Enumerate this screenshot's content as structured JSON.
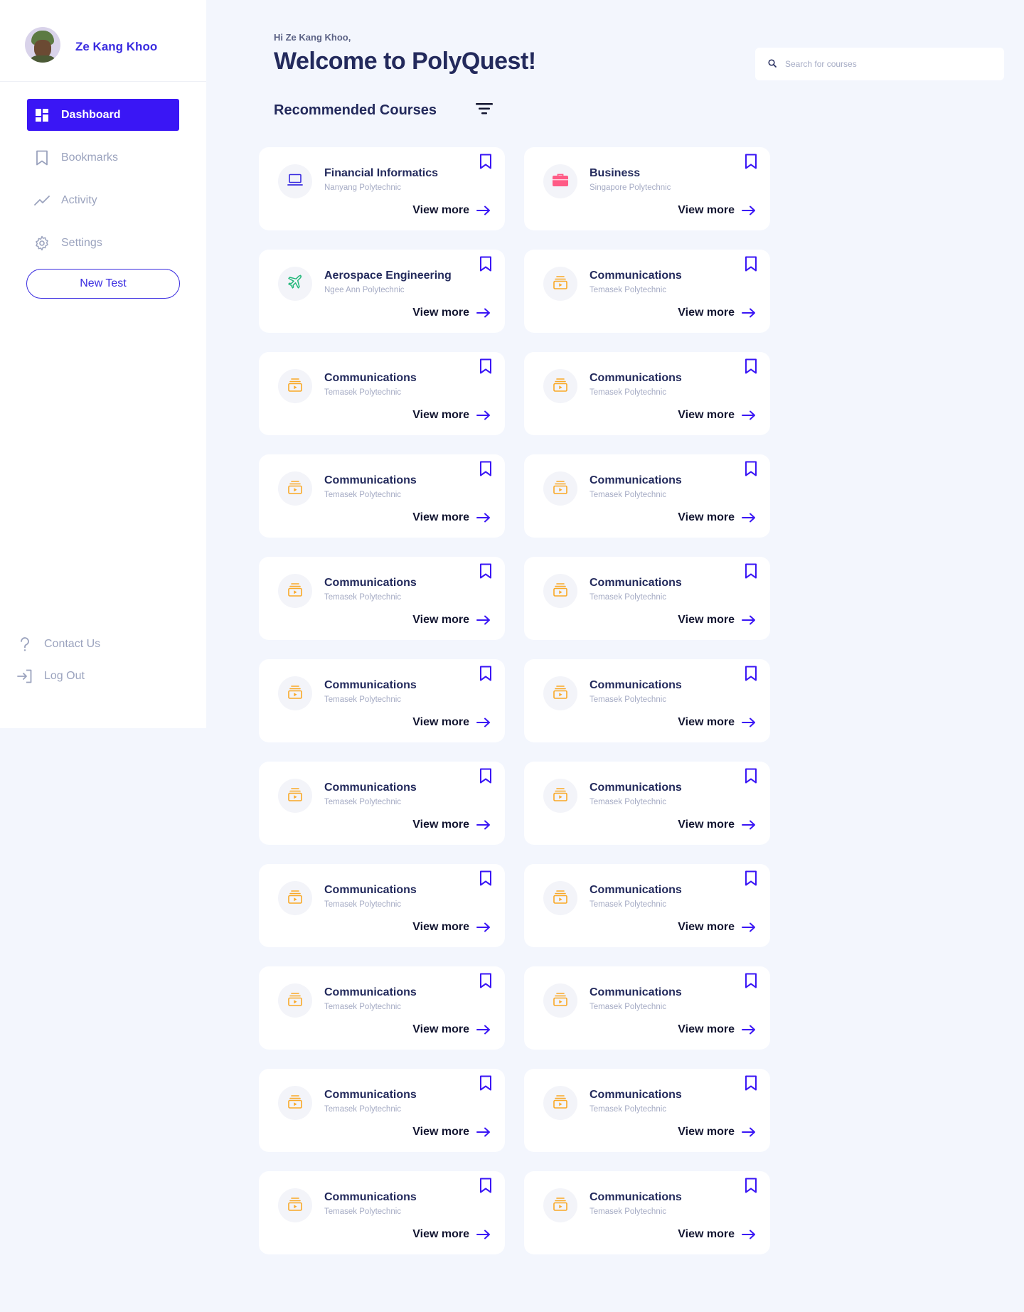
{
  "user": {
    "name": "Ze Kang Khoo"
  },
  "nav": {
    "dashboard": "Dashboard",
    "bookmarks": "Bookmarks",
    "activity": "Activity",
    "settings": "Settings",
    "new_test": "New Test",
    "contact": "Contact Us",
    "logout": "Log Out"
  },
  "header": {
    "greeting": "Hi Ze Kang Khoo,",
    "title": "Welcome to PolyQuest!",
    "search_placeholder": "Search for courses"
  },
  "section": {
    "title": "Recommended Courses"
  },
  "view_more": "View more",
  "colors": {
    "accent": "#3a16f5",
    "title": "#232a5c",
    "muted": "#a5abc4",
    "laptop": "#3a2ce0",
    "briefcase": "#ff5b86",
    "plane": "#23b87a",
    "media": "#f9a826"
  },
  "courses": [
    {
      "title": "Financial Informatics",
      "school": "Nanyang Polytechnic",
      "icon": "laptop-icon"
    },
    {
      "title": "Business",
      "school": "Singapore Polytechnic",
      "icon": "briefcase-icon"
    },
    {
      "title": "Aerospace Engineering",
      "school": "Ngee Ann Polytechnic",
      "icon": "plane-icon"
    },
    {
      "title": "Communications",
      "school": "Temasek Polytechnic",
      "icon": "media-icon"
    },
    {
      "title": "Communications",
      "school": "Temasek Polytechnic",
      "icon": "media-icon"
    },
    {
      "title": "Communications",
      "school": "Temasek Polytechnic",
      "icon": "media-icon"
    },
    {
      "title": "Communications",
      "school": "Temasek Polytechnic",
      "icon": "media-icon"
    },
    {
      "title": "Communications",
      "school": "Temasek Polytechnic",
      "icon": "media-icon"
    },
    {
      "title": "Communications",
      "school": "Temasek Polytechnic",
      "icon": "media-icon"
    },
    {
      "title": "Communications",
      "school": "Temasek Polytechnic",
      "icon": "media-icon"
    },
    {
      "title": "Communications",
      "school": "Temasek Polytechnic",
      "icon": "media-icon"
    },
    {
      "title": "Communications",
      "school": "Temasek Polytechnic",
      "icon": "media-icon"
    },
    {
      "title": "Communications",
      "school": "Temasek Polytechnic",
      "icon": "media-icon"
    },
    {
      "title": "Communications",
      "school": "Temasek Polytechnic",
      "icon": "media-icon"
    },
    {
      "title": "Communications",
      "school": "Temasek Polytechnic",
      "icon": "media-icon"
    },
    {
      "title": "Communications",
      "school": "Temasek Polytechnic",
      "icon": "media-icon"
    },
    {
      "title": "Communications",
      "school": "Temasek Polytechnic",
      "icon": "media-icon"
    },
    {
      "title": "Communications",
      "school": "Temasek Polytechnic",
      "icon": "media-icon"
    },
    {
      "title": "Communications",
      "school": "Temasek Polytechnic",
      "icon": "media-icon"
    },
    {
      "title": "Communications",
      "school": "Temasek Polytechnic",
      "icon": "media-icon"
    },
    {
      "title": "Communications",
      "school": "Temasek Polytechnic",
      "icon": "media-icon"
    },
    {
      "title": "Communications",
      "school": "Temasek Polytechnic",
      "icon": "media-icon"
    }
  ]
}
